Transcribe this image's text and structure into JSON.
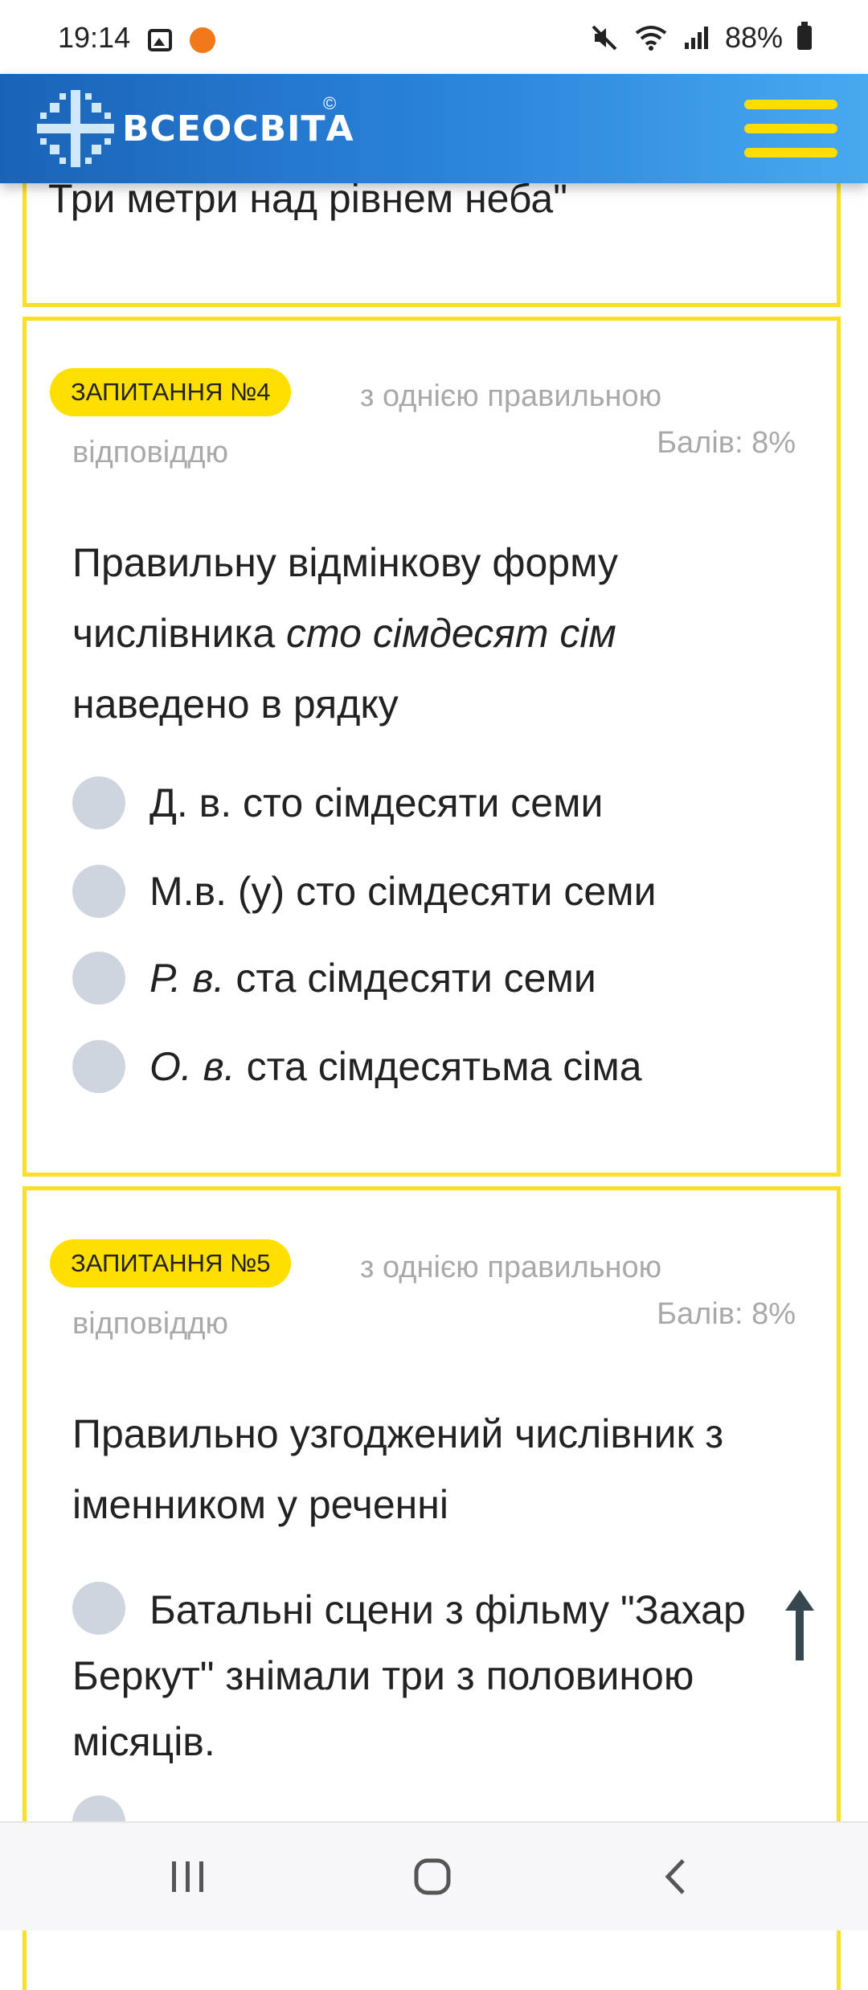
{
  "status_bar": {
    "time": "19:14",
    "battery": "88%",
    "icons": [
      "gallery-icon",
      "app-icon",
      "mute-icon",
      "wifi-icon",
      "signal-icon",
      "battery-icon"
    ]
  },
  "header": {
    "logo_text": "ВСЕОСВІТА",
    "copyright": "©",
    "menu_icon": "hamburger-icon"
  },
  "previous_question": {
    "tail_text": "Три метри над рівнем неба\""
  },
  "questions": [
    {
      "badge": "ЗАПИТАННЯ №4",
      "type_line1": "з однією правильною",
      "type_line2": "відповіддю",
      "points": "Балів: 8%",
      "text_part1": "Правильну відмінкову форму",
      "text_part2": "числівника ",
      "text_italic": "сто сімдесят сім",
      "text_part3": "наведено в рядку",
      "options": [
        {
          "prefix": "",
          "text": "Д. в. сто сімдесяти семи"
        },
        {
          "prefix": "",
          "text": "М.в. (у) сто сімдесяти семи"
        },
        {
          "prefix": "Р. в.",
          "text": "ста сімдесяти семи"
        },
        {
          "prefix": "О. в.",
          "text": "ста сімдесятьма сіма"
        }
      ]
    },
    {
      "badge": "ЗАПИТАННЯ №5",
      "type_line1": "з однією правильною",
      "type_line2": "відповіддю",
      "points": "Балів: 8%",
      "text_line1": "Правильно узгоджений числівник з",
      "text_line2": "іменником у реченні",
      "options": [
        {
          "text": "Батальні сцени з фільму \"Захар Беркут\" знімали три з половиною місяців."
        }
      ]
    }
  ],
  "colors": {
    "accent_yellow": "#ffdf00",
    "header_blue": "#2b86dc",
    "radio_gray": "#cfd5de",
    "muted_text": "#a9a9a9"
  }
}
